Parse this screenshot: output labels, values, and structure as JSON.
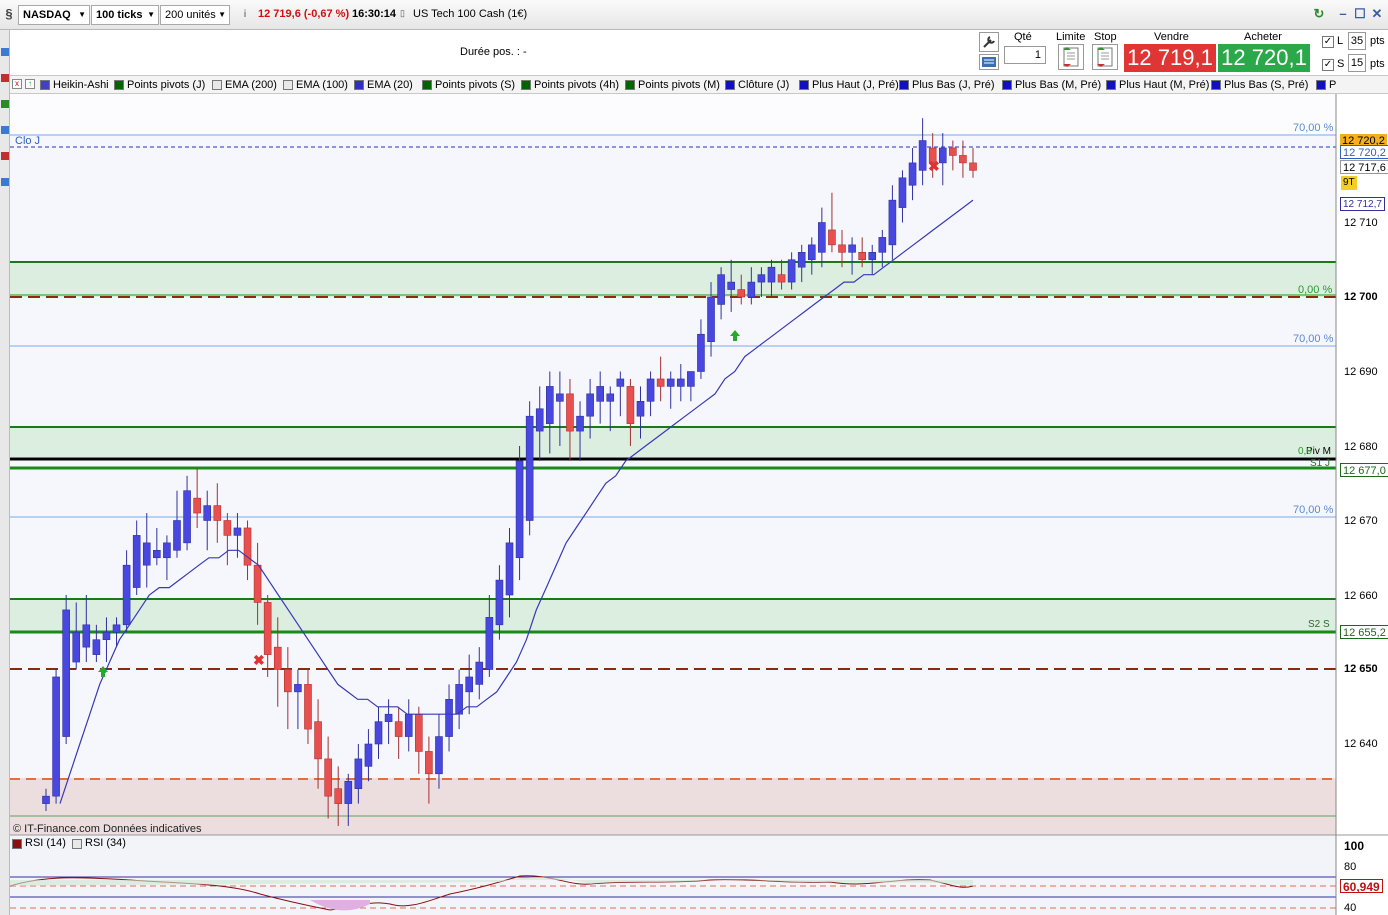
{
  "topbar": {
    "instrument": "NASDAQ",
    "timeframe": "100 ticks",
    "units": "200 unités",
    "last_change": "12 719,6 (-0,67 %)",
    "time": "16:30:14",
    "name": "US Tech 100 Cash (1€)"
  },
  "order_panel": {
    "duree_pos": "Durée pos. :  -",
    "qte_label": "Qté",
    "qte_value": "1",
    "limite_label": "Limite",
    "stop_label": "Stop",
    "vendre_label": "Vendre",
    "vendre_price": "12 719,1",
    "acheter_label": "Acheter",
    "acheter_price": "12 720,1",
    "l_label": "L",
    "l_value": "35",
    "s_label": "S",
    "s_value": "15",
    "pts": "pts"
  },
  "indicators": [
    {
      "label": "Heikin-Ashi",
      "color": "#4040c0"
    },
    {
      "label": "Points pivots (J)",
      "color": "#006400"
    },
    {
      "label": "EMA (200)",
      "color": "#e8e8e8"
    },
    {
      "label": "EMA (100)",
      "color": "#e8e8e8"
    },
    {
      "label": "EMA (20)",
      "color": "#3030c0"
    },
    {
      "label": "Points pivots (S)",
      "color": "#006400"
    },
    {
      "label": "Points pivots (4h)",
      "color": "#006400"
    },
    {
      "label": "Points pivots (M)",
      "color": "#006400"
    },
    {
      "label": "Clôture (J)",
      "color": "#1010c0"
    },
    {
      "label": "Plus Haut (J, Pré)",
      "color": "#1010c0"
    },
    {
      "label": "Plus Bas (J, Pré)",
      "color": "#1010c0"
    },
    {
      "label": "Plus Bas (M, Pré)",
      "color": "#1010c0"
    },
    {
      "label": "Plus Haut (M, Pré)",
      "color": "#1010c0"
    },
    {
      "label": "Plus Bas (S, Pré)",
      "color": "#1010c0"
    },
    {
      "label": "P",
      "color": "#1010c0"
    }
  ],
  "chart": {
    "clo_j_label": "Clo J",
    "pct_labels": [
      "70,00 %",
      "0,00 %",
      "70,00 %",
      "70,00 %"
    ],
    "zone_labels": [
      "Piv M",
      "S1 J",
      "S2 S",
      "0,0"
    ],
    "axis_ticks": [
      "12 710",
      "12 700",
      "12 690",
      "12 680",
      "12 670",
      "12 660",
      "12 650",
      "12 640"
    ],
    "price_tags": {
      "t1": "12 720,2",
      "t2": "12 720,2",
      "t3": "12 717,6",
      "nt": "9T",
      "t4": "12 712,7",
      "t5": "12 677,0",
      "t6": "12 655,2"
    },
    "footer": "© IT-Finance.com  Données indicatives"
  },
  "rsi": {
    "items": [
      "RSI (14)",
      "RSI (34)"
    ],
    "axis": [
      "100",
      "80",
      "40"
    ],
    "value": "60,949"
  },
  "chart_data": {
    "type": "candlestick",
    "ylim": [
      12630,
      12725
    ],
    "candles": [
      [
        12632,
        12634,
        12631,
        12633
      ],
      [
        12633,
        12650,
        12632,
        12649
      ],
      [
        12641,
        12660,
        12640,
        12658
      ],
      [
        12651,
        12659,
        12650,
        12655
      ],
      [
        12653,
        12660,
        12651,
        12656
      ],
      [
        12652,
        12656,
        12651,
        12654
      ],
      [
        12654,
        12657,
        12651,
        12655
      ],
      [
        12655,
        12657,
        12653,
        12656
      ],
      [
        12656,
        12666,
        12655,
        12664
      ],
      [
        12661,
        12670,
        12660,
        12668
      ],
      [
        12664,
        12671,
        12661,
        12667
      ],
      [
        12665,
        12669,
        12664,
        12666
      ],
      [
        12665,
        12668,
        12662,
        12667
      ],
      [
        12666,
        12674,
        12665,
        12670
      ],
      [
        12667,
        12676,
        12666,
        12674
      ],
      [
        12673,
        12677,
        12669,
        12671
      ],
      [
        12670,
        12674,
        12666,
        12672
      ],
      [
        12672,
        12675,
        12667,
        12670
      ],
      [
        12670,
        12671,
        12664,
        12668
      ],
      [
        12668,
        12671,
        12665,
        12669
      ],
      [
        12669,
        12670,
        12662,
        12664
      ],
      [
        12664,
        12667,
        12656,
        12659
      ],
      [
        12659,
        12660,
        12649,
        12652
      ],
      [
        12653,
        12657,
        12645,
        12650
      ],
      [
        12650,
        12653,
        12642,
        12647
      ],
      [
        12647,
        12650,
        12642,
        12648
      ],
      [
        12648,
        12650,
        12640,
        12642
      ],
      [
        12643,
        12646,
        12634,
        12638
      ],
      [
        12638,
        12641,
        12630,
        12633
      ],
      [
        12634,
        12637,
        12629,
        12632
      ],
      [
        12632,
        12636,
        12629,
        12635
      ],
      [
        12634,
        12640,
        12632,
        12638
      ],
      [
        12637,
        12642,
        12635,
        12640
      ],
      [
        12640,
        12645,
        12638,
        12643
      ],
      [
        12643,
        12646,
        12640,
        12644
      ],
      [
        12643,
        12645,
        12638,
        12641
      ],
      [
        12641,
        12646,
        12639,
        12644
      ],
      [
        12644,
        12645,
        12636,
        12639
      ],
      [
        12639,
        12641,
        12632,
        12636
      ],
      [
        12636,
        12644,
        12634,
        12641
      ],
      [
        12641,
        12648,
        12639,
        12646
      ],
      [
        12644,
        12650,
        12642,
        12648
      ],
      [
        12647,
        12652,
        12644,
        12649
      ],
      [
        12648,
        12653,
        12646,
        12651
      ],
      [
        12650,
        12660,
        12649,
        12657
      ],
      [
        12656,
        12664,
        12654,
        12662
      ],
      [
        12660,
        12669,
        12657,
        12667
      ],
      [
        12665,
        12680,
        12662,
        12678
      ],
      [
        12670,
        12686,
        12668,
        12684
      ],
      [
        12682,
        12688,
        12678,
        12685
      ],
      [
        12683,
        12690,
        12679,
        12688
      ],
      [
        12686,
        12690,
        12680,
        12687
      ],
      [
        12687,
        12689,
        12678,
        12682
      ],
      [
        12682,
        12686,
        12678,
        12684
      ],
      [
        12684,
        12689,
        12681,
        12687
      ],
      [
        12686,
        12690,
        12683,
        12688
      ],
      [
        12686,
        12688,
        12682,
        12687
      ],
      [
        12688,
        12690,
        12684,
        12689
      ],
      [
        12688,
        12689,
        12680,
        12683
      ],
      [
        12684,
        12688,
        12681,
        12686
      ],
      [
        12686,
        12690,
        12684,
        12689
      ],
      [
        12689,
        12692,
        12686,
        12688
      ],
      [
        12688,
        12690,
        12685,
        12689
      ],
      [
        12688,
        12691,
        12686,
        12689
      ],
      [
        12688,
        12690,
        12686,
        12690
      ],
      [
        12690,
        12697,
        12689,
        12695
      ],
      [
        12694,
        12702,
        12692,
        12700
      ],
      [
        12699,
        12704,
        12697,
        12703
      ],
      [
        12701,
        12705,
        12698,
        12702
      ],
      [
        12701,
        12703,
        12699,
        12700
      ],
      [
        12700,
        12704,
        12699,
        12702
      ],
      [
        12702,
        12704,
        12700,
        12703
      ],
      [
        12702,
        12705,
        12700,
        12704
      ],
      [
        12703,
        12705,
        12701,
        12702
      ],
      [
        12702,
        12706,
        12701,
        12705
      ],
      [
        12704,
        12707,
        12702,
        12706
      ],
      [
        12705,
        12708,
        12703,
        12707
      ],
      [
        12706,
        12712,
        12704,
        12710
      ],
      [
        12709,
        12714,
        12706,
        12707
      ],
      [
        12707,
        12709,
        12704,
        12706
      ],
      [
        12706,
        12708,
        12703,
        12707
      ],
      [
        12706,
        12708,
        12704,
        12705
      ],
      [
        12705,
        12707,
        12703,
        12706
      ],
      [
        12706,
        12709,
        12704,
        12708
      ],
      [
        12707,
        12715,
        12705,
        12713
      ],
      [
        12712,
        12717,
        12710,
        12716
      ],
      [
        12715,
        12720,
        12713,
        12718
      ],
      [
        12717,
        12724,
        12715,
        12721
      ],
      [
        12720,
        12722,
        12716,
        12718
      ],
      [
        12718,
        12722,
        12715,
        12720
      ],
      [
        12720,
        12721,
        12717,
        12719
      ],
      [
        12719,
        12721,
        12716,
        12718
      ],
      [
        12718,
        12720,
        12716,
        12717
      ]
    ],
    "ema20": [
      12632,
      12636,
      12640,
      12644,
      12648,
      12651,
      12654,
      12656,
      12658,
      12660,
      12661,
      12661,
      12662,
      12663,
      12664,
      12665,
      12665,
      12666,
      12666,
      12665,
      12664,
      12662,
      12660,
      12658,
      12656,
      12654,
      12652,
      12650,
      12648,
      12647,
      12646,
      12646,
      12645,
      12645,
      12645,
      12644,
      12644,
      12644,
      12644,
      12644,
      12644,
      12645,
      12645,
      12646,
      12647,
      12649,
      12651,
      12654,
      12658,
      12661,
      12664,
      12667,
      12669,
      12671,
      12673,
      12675,
      12676,
      12678,
      12679,
      12680,
      12681,
      12682,
      12683,
      12684,
      12685,
      12686,
      12687,
      12689,
      12690,
      12692,
      12693,
      12694,
      12695,
      12696,
      12697,
      12698,
      12699,
      12700,
      12701,
      12702,
      12702,
      12703,
      12703,
      12704,
      12705,
      12706,
      12707,
      12708,
      12709,
      12710,
      12711,
      12712,
      12713
    ]
  }
}
